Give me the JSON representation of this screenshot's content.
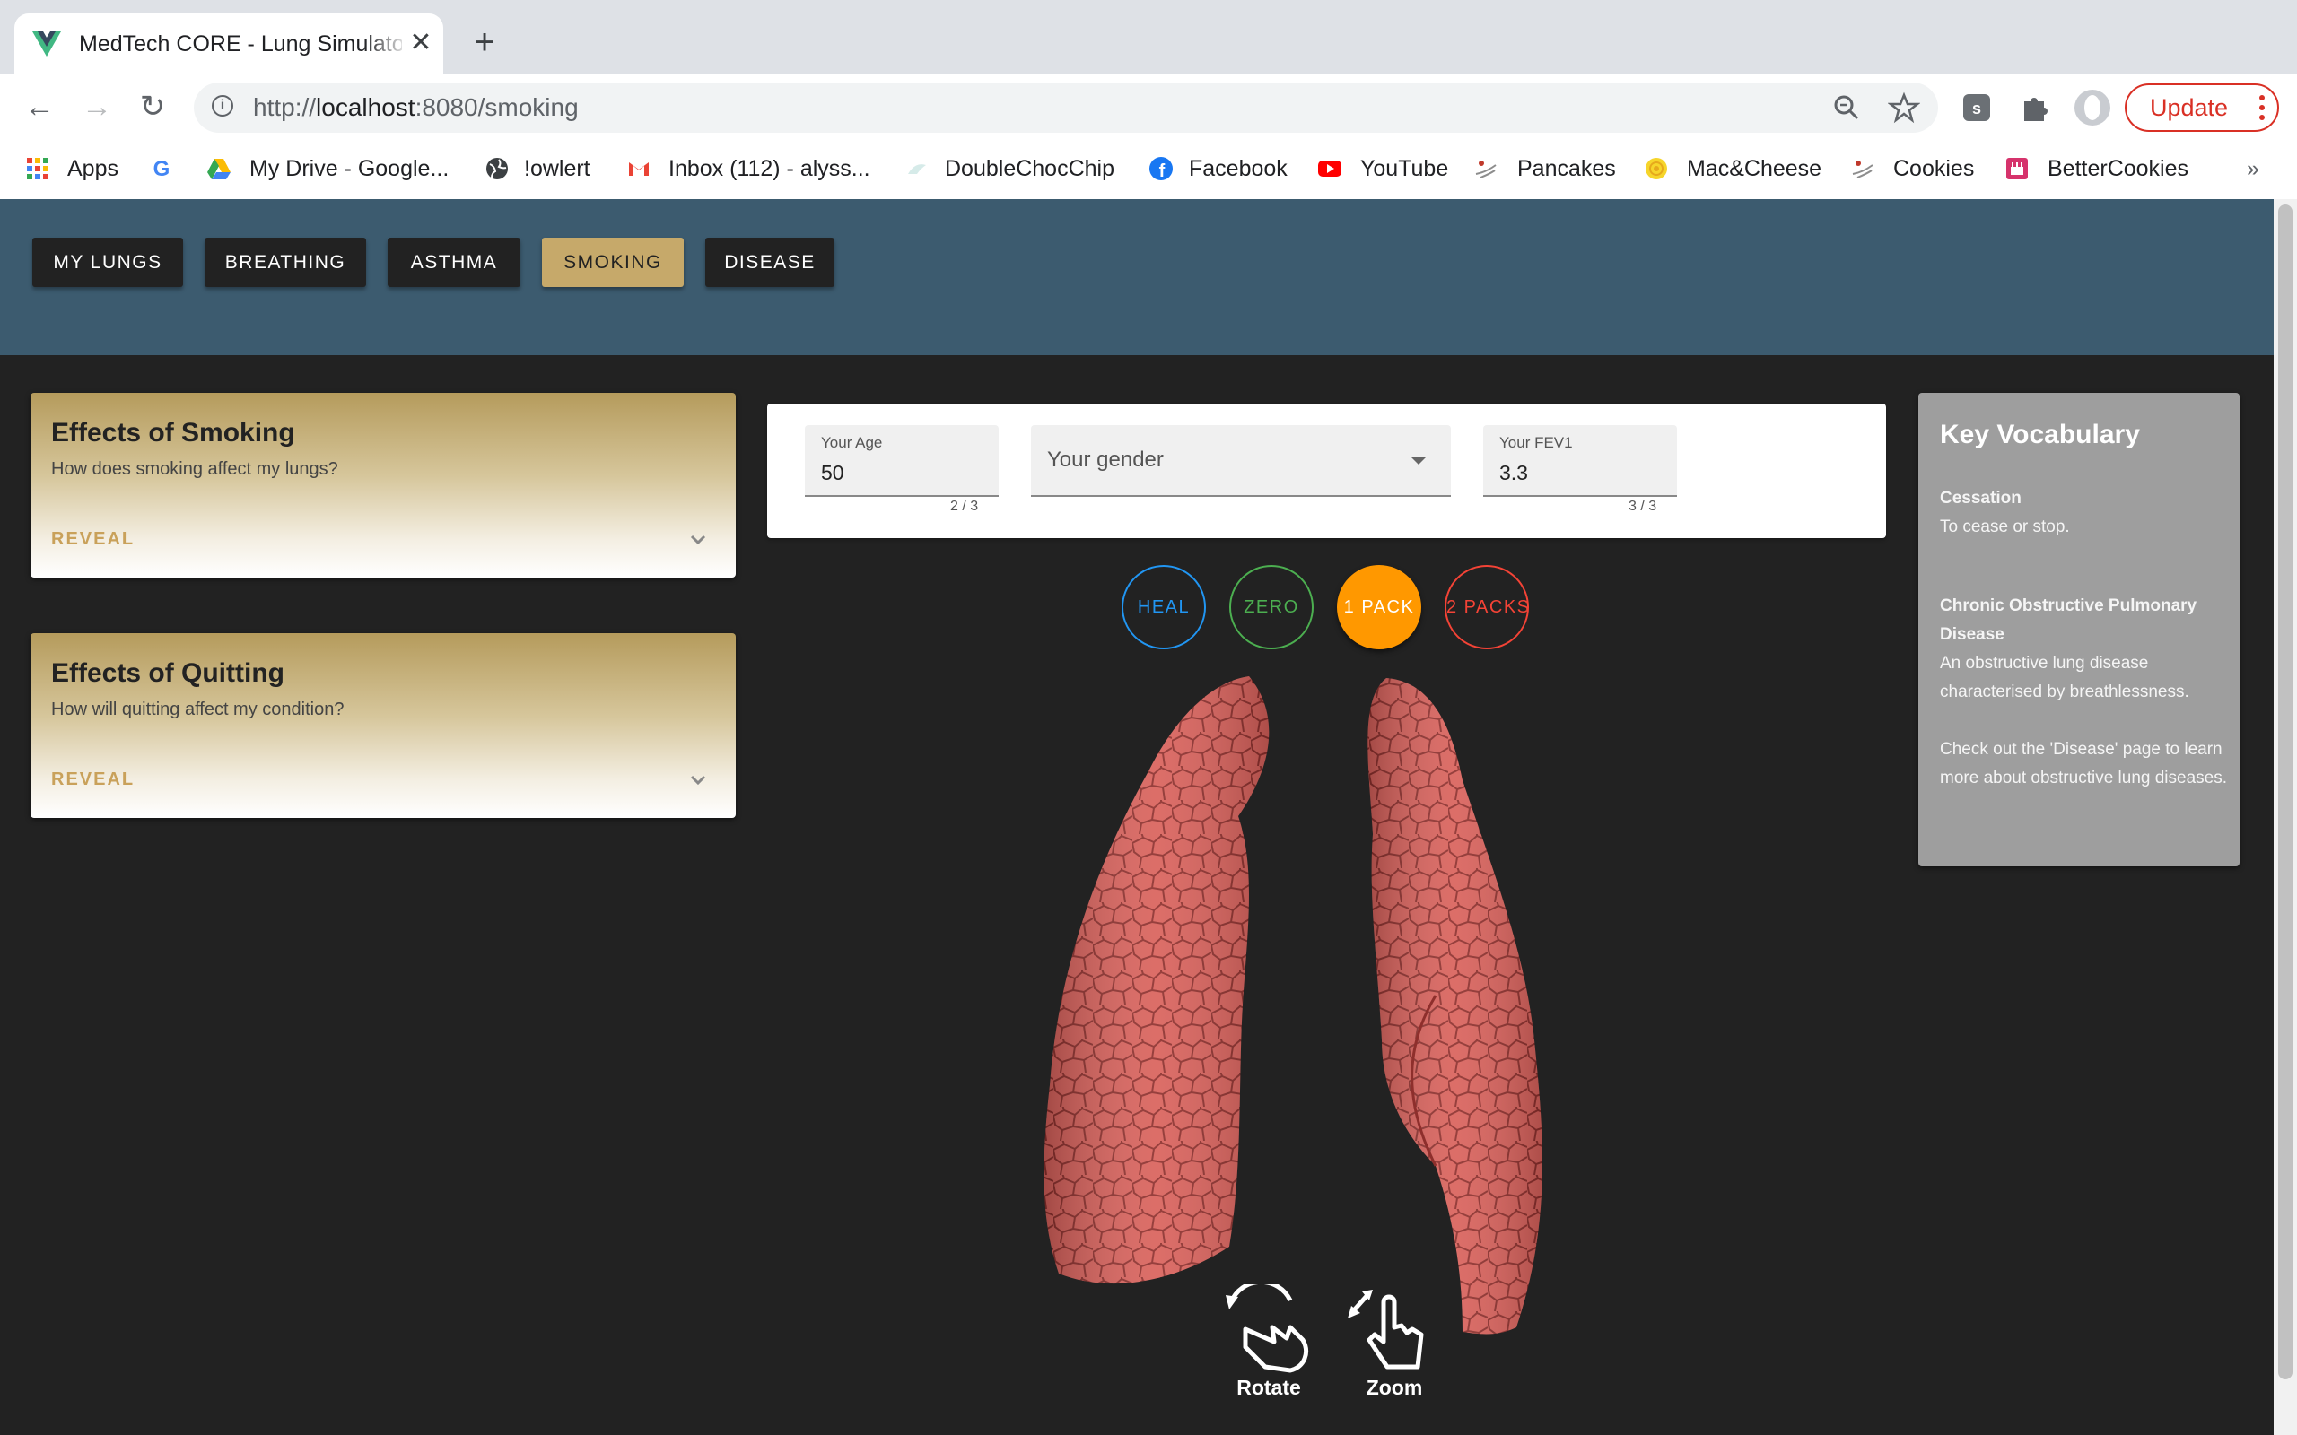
{
  "browser": {
    "tab_title": "MedTech CORE - Lung Simulator",
    "url_scheme": "http://",
    "url_host": "localhost",
    "url_path": ":8080/smoking",
    "update_label": "Update",
    "bookmarks": [
      {
        "label": "Apps",
        "icon": "apps-grid-icon"
      },
      {
        "label": "",
        "icon": "google-icon"
      },
      {
        "label": "My Drive - Google...",
        "icon": "google-drive-icon"
      },
      {
        "label": "!owlert",
        "icon": "globe-icon"
      },
      {
        "label": "Inbox (112) - alyss...",
        "icon": "gmail-icon"
      },
      {
        "label": "DoubleChocChip",
        "icon": "bookmark-icon"
      },
      {
        "label": "Facebook",
        "icon": "facebook-icon"
      },
      {
        "label": "YouTube",
        "icon": "youtube-icon"
      },
      {
        "label": "Pancakes",
        "icon": "recipe-icon"
      },
      {
        "label": "Mac&Cheese",
        "icon": "recipe-icon"
      },
      {
        "label": "Cookies",
        "icon": "recipe-icon"
      },
      {
        "label": "BetterCookies",
        "icon": "recipe-icon"
      }
    ],
    "more_bookmarks": "»"
  },
  "nav": {
    "items": [
      {
        "label": "MY LUNGS",
        "active": false
      },
      {
        "label": "BREATHING",
        "active": false
      },
      {
        "label": "ASTHMA",
        "active": false
      },
      {
        "label": "SMOKING",
        "active": true
      },
      {
        "label": "DISEASE",
        "active": false
      }
    ]
  },
  "cards": [
    {
      "title": "Effects of Smoking",
      "subtitle": "How does smoking affect my lungs?",
      "action": "REVEAL"
    },
    {
      "title": "Effects of Quitting",
      "subtitle": "How will quitting affect my condition?",
      "action": "REVEAL"
    }
  ],
  "form": {
    "age": {
      "label": "Your Age",
      "value": "50",
      "counter": "2 / 3"
    },
    "gender": {
      "placeholder": "Your gender"
    },
    "fev1": {
      "label": "Your FEV1",
      "value": "3.3",
      "counter": "3 / 3"
    }
  },
  "smoking_levels": [
    {
      "label": "HEAL",
      "color": "#2196f3",
      "selected": false
    },
    {
      "label": "ZERO",
      "color": "#4caf50",
      "selected": false
    },
    {
      "label": "1 PACK",
      "color": "#ff9800",
      "selected": true
    },
    {
      "label": "2 PACKS",
      "color": "#f44336",
      "selected": false
    }
  ],
  "gestures": {
    "rotate": "Rotate",
    "zoom": "Zoom"
  },
  "vocab": {
    "title": "Key Vocabulary",
    "entries": [
      {
        "term": "Cessation",
        "definition": "To cease or stop."
      },
      {
        "term": "Chronic Obstructive Pulmonary Disease",
        "definition": "An obstructive lung disease characterised by breathlessness.",
        "note": "Check out the 'Disease' page to learn more about obstructive lung diseases."
      }
    ]
  },
  "colors": {
    "header_bg": "#3c5b6f",
    "page_bg": "#222222",
    "active_nav": "#c6a96a",
    "lung": "#d9615b"
  }
}
